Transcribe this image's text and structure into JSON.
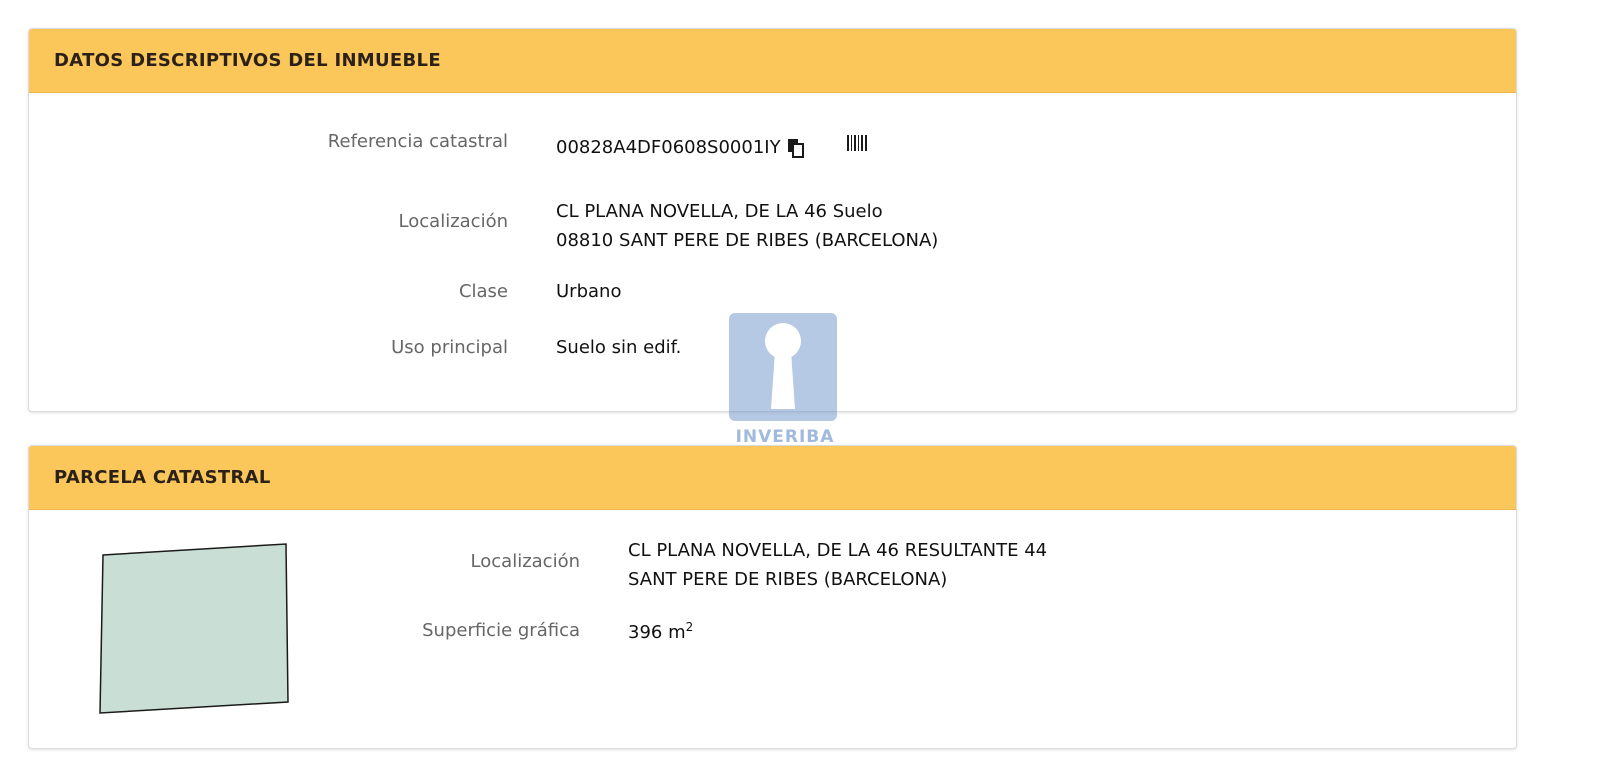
{
  "panel1": {
    "title": "DATOS DESCRIPTIVOS DEL INMUEBLE",
    "referencia_label": "Referencia catastral",
    "referencia_value": "00828A4DF0608S0001IY",
    "localizacion_label": "Localización",
    "localizacion_line1": "CL PLANA NOVELLA, DE LA 46 Suelo",
    "localizacion_line2": "08810 SANT PERE DE RIBES (BARCELONA)",
    "clase_label": "Clase",
    "clase_value": "Urbano",
    "uso_label": "Uso principal",
    "uso_value": "Suelo sin edif."
  },
  "panel2": {
    "title": "PARCELA CATASTRAL",
    "localizacion_label": "Localización",
    "localizacion_line1": "CL PLANA NOVELLA, DE LA 46 RESULTANTE 44",
    "localizacion_line2": "SANT PERE DE RIBES (BARCELONA)",
    "superficie_label": "Superficie gráfica",
    "superficie_value": "396 m",
    "superficie_unit_sup": "2"
  },
  "watermark": {
    "text": "INVERIBA"
  },
  "icons": {
    "copy": "copy-icon",
    "barcode": "barcode-icon",
    "keyhole": "keyhole-icon"
  },
  "colors": {
    "header_bg": "#fbc75a",
    "parcel_fill": "#c9dfd6",
    "watermark": "#789bcd"
  }
}
